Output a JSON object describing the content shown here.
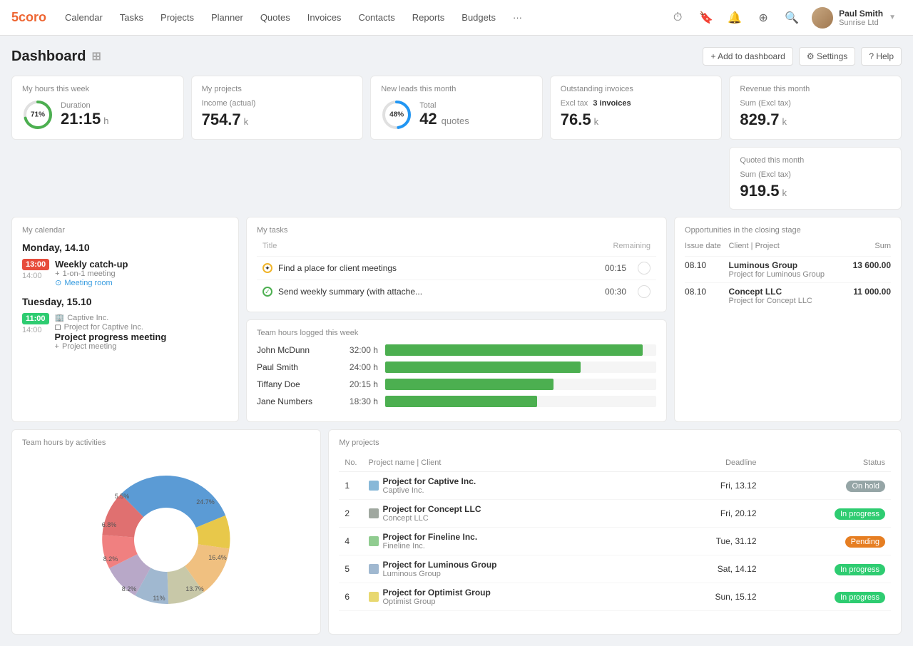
{
  "logo": {
    "text": "5coro"
  },
  "nav": {
    "items": [
      {
        "label": "Calendar"
      },
      {
        "label": "Tasks"
      },
      {
        "label": "Projects"
      },
      {
        "label": "Planner"
      },
      {
        "label": "Quotes"
      },
      {
        "label": "Invoices"
      },
      {
        "label": "Contacts"
      },
      {
        "label": "Reports"
      },
      {
        "label": "Budgets"
      }
    ],
    "more_label": "···"
  },
  "user": {
    "name": "Paul Smith",
    "company": "Sunrise Ltd"
  },
  "dashboard": {
    "title": "Dashboard",
    "add_button": "+ Add to dashboard",
    "settings_button": "⚙ Settings",
    "help_button": "? Help"
  },
  "stats": [
    {
      "label": "My hours this week",
      "show_circle": true,
      "pct": 71,
      "value": "21:15",
      "unit": "h",
      "sublabel": "Duration"
    },
    {
      "label": "My projects",
      "sublabel": "Income (actual)",
      "value": "754.7",
      "unit": "k"
    },
    {
      "label": "New leads this month",
      "show_circle": true,
      "pct": 48,
      "sublabel": "Total",
      "value": "42",
      "unit": "quotes"
    },
    {
      "label": "Outstanding invoices",
      "sublabel": "Excl tax",
      "highlight": "3 invoices",
      "value": "76.5",
      "unit": "k"
    },
    {
      "label": "Revenue this month",
      "sublabel": "Sum (Excl tax)",
      "value": "829.7",
      "unit": "k"
    },
    {
      "label": "Quoted this month",
      "sublabel": "Sum (Excl tax)",
      "value": "919.5",
      "unit": "k"
    }
  ],
  "calendar": {
    "label": "My calendar",
    "days": [
      {
        "header": "Monday, 14.10",
        "events": [
          {
            "time_start": "13:00",
            "time_end": "14:00",
            "title": "Weekly catch-up",
            "sub1": "1-on-1 meeting",
            "sub2": "Meeting room",
            "color": "red"
          }
        ]
      },
      {
        "header": "Tuesday, 15.10",
        "events": [
          {
            "time_start": "11:00",
            "time_end": "14:00",
            "title": "Project progress meeting",
            "company": "Captive Inc.",
            "project": "Project for Captive Inc.",
            "sub1": "Project meeting",
            "color": "green"
          }
        ]
      }
    ]
  },
  "tasks": {
    "label": "My tasks",
    "columns": [
      "Title",
      "Remaining"
    ],
    "items": [
      {
        "title": "Find a place for client meetings",
        "time": "00:15",
        "done": false
      },
      {
        "title": "Send weekly summary (with attache...",
        "time": "00:30",
        "done": true
      }
    ]
  },
  "opportunities": {
    "label": "Opportunities in the closing stage",
    "columns": [
      "Issue date",
      "Client | Project",
      "Sum"
    ],
    "items": [
      {
        "date": "08.10",
        "client": "Luminous Group",
        "project": "Project for Luminous Group",
        "sum": "13 600.00"
      },
      {
        "date": "08.10",
        "client": "Concept LLC",
        "project": "Project for Concept LLC",
        "sum": "11 000.00"
      }
    ]
  },
  "team_hours": {
    "label": "Team hours logged this week",
    "members": [
      {
        "name": "John McDunn",
        "hours": "32:00 h",
        "bar_pct": 95
      },
      {
        "name": "Paul Smith",
        "hours": "24:00 h",
        "bar_pct": 72
      },
      {
        "name": "Tiffany Doe",
        "hours": "20:15 h",
        "bar_pct": 62
      },
      {
        "name": "Jane Numbers",
        "hours": "18:30 h",
        "bar_pct": 56
      }
    ]
  },
  "pie_chart": {
    "label": "Team hours by activities",
    "segments": [
      {
        "label": "24.7%",
        "value": 24.7,
        "color": "#5b9bd5"
      },
      {
        "label": "16.4%",
        "value": 16.4,
        "color": "#e8c84a"
      },
      {
        "label": "13.7%",
        "value": 13.7,
        "color": "#f0c080"
      },
      {
        "label": "11%",
        "value": 11,
        "color": "#c8c8a8"
      },
      {
        "label": "8.2%",
        "value": 8.2,
        "color": "#a0b8d0"
      },
      {
        "label": "8.2%",
        "value": 8.2,
        "color": "#b8a8c8"
      },
      {
        "label": "6.8%",
        "value": 6.8,
        "color": "#f08080"
      },
      {
        "label": "5.5%",
        "value": 5.5,
        "color": "#e07070"
      }
    ]
  },
  "projects": {
    "label": "My projects",
    "columns": [
      "No.",
      "Project name | Client",
      "Deadline",
      "Status"
    ],
    "items": [
      {
        "no": "1",
        "name": "Project for Captive Inc.",
        "client": "Captive Inc.",
        "deadline": "Fri, 13.12",
        "status": "On hold",
        "status_class": "status-onhold",
        "icon_color": "#88b8d8"
      },
      {
        "no": "2",
        "name": "Project for Concept LLC",
        "client": "Concept LLC",
        "deadline": "Fri, 20.12",
        "status": "In progress",
        "status_class": "status-inprogress",
        "icon_color": "#a0a8a0"
      },
      {
        "no": "4",
        "name": "Project for Fineline Inc.",
        "client": "Fineline Inc.",
        "deadline": "Tue, 31.12",
        "status": "Pending",
        "status_class": "status-pending",
        "icon_color": "#90cc90"
      },
      {
        "no": "5",
        "name": "Project for Luminous Group",
        "client": "Luminous Group",
        "deadline": "Sat, 14.12",
        "status": "In progress",
        "status_class": "status-inprogress",
        "icon_color": "#a0b8d0"
      },
      {
        "no": "6",
        "name": "Project for Optimist Group",
        "client": "Optimist Group",
        "deadline": "Sun, 15.12",
        "status": "In progress",
        "status_class": "status-inprogress",
        "icon_color": "#e8d870"
      }
    ]
  }
}
